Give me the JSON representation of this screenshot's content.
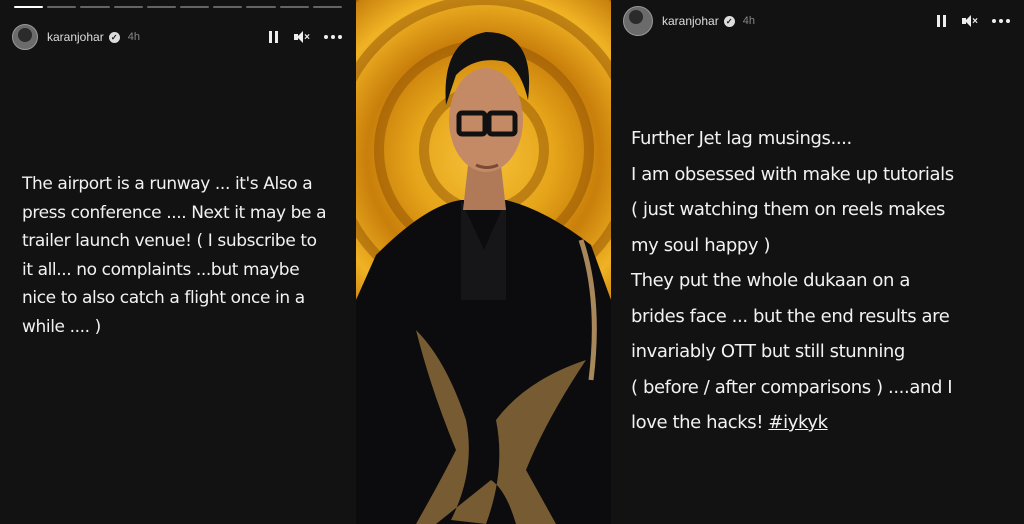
{
  "left_story": {
    "username": "karanjohar",
    "time": "4h",
    "caption": "The airport is a runway ... it's Also a\npress conference .... Next it may be a\ntrailer launch venue! ( I subscribe to\nit all... no complaints ...but maybe\nnice to also catch a flight once in a\nwhile .... )"
  },
  "right_story": {
    "username": "karanjohar",
    "time": "4h",
    "caption": "Further Jet lag musings....\nI am obsessed with make up tutorials\n( just watching them on reels makes\nmy soul happy )\nThey put the whole dukaan on a\nbrides face ... but the end results are\ninvariably OTT but still stunning\n( before / after comparisons ) ....and I\nlove the hacks! ",
    "hashtag": "#iykyk"
  },
  "icons": {
    "pause": "pause-icon",
    "mute": "mute-icon",
    "more": "more-icon",
    "verified": "verified-badge-icon"
  },
  "colors": {
    "story_bg": "#121212",
    "photo_bg_accent": "#e6a51a"
  }
}
